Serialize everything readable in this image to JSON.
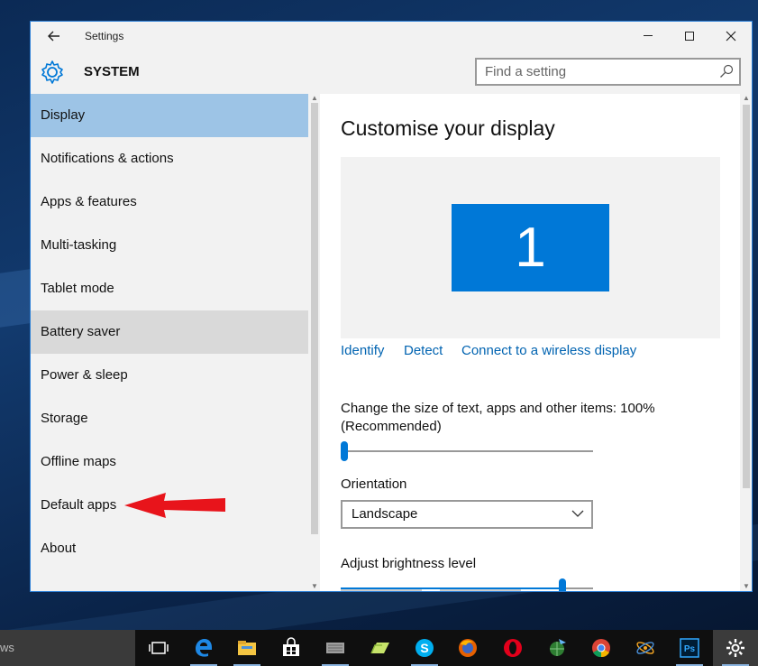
{
  "window": {
    "title": "Settings",
    "section": "SYSTEM",
    "search_placeholder": "Find a setting"
  },
  "sidebar": {
    "items": [
      {
        "label": "Display"
      },
      {
        "label": "Notifications & actions"
      },
      {
        "label": "Apps & features"
      },
      {
        "label": "Multi-tasking"
      },
      {
        "label": "Tablet mode"
      },
      {
        "label": "Battery saver"
      },
      {
        "label": "Power & sleep"
      },
      {
        "label": "Storage"
      },
      {
        "label": "Offline maps"
      },
      {
        "label": "Default apps"
      },
      {
        "label": "About"
      }
    ],
    "selected_index": 0,
    "hover_index": 5
  },
  "display": {
    "heading": "Customise your display",
    "monitor_number": "1",
    "links": {
      "identify": "Identify",
      "detect": "Detect",
      "connect": "Connect to a wireless display"
    },
    "scale_label": "Change the size of text, apps and other items: 100%",
    "scale_sub": "(Recommended)",
    "scale_value_fraction": 0.0,
    "orientation_label": "Orientation",
    "orientation_value": "Landscape",
    "brightness_label": "Adjust brightness level",
    "brightness_value_fraction": 0.89
  },
  "taskbar": {
    "search_text": "ws",
    "icons": [
      "task-view-icon",
      "edge-icon",
      "file-explorer-icon",
      "store-icon",
      "network-app-icon",
      "folder-app-icon",
      "skype-icon",
      "firefox-icon",
      "opera-icon",
      "globe-app-icon",
      "chrome-icon",
      "atom-app-icon",
      "photoshop-icon",
      "settings-icon"
    ]
  },
  "colors": {
    "accent": "#0078d7",
    "selected_nav": "#9dc4e6",
    "link": "#0063b1",
    "annotation_arrow": "#e8141b"
  }
}
